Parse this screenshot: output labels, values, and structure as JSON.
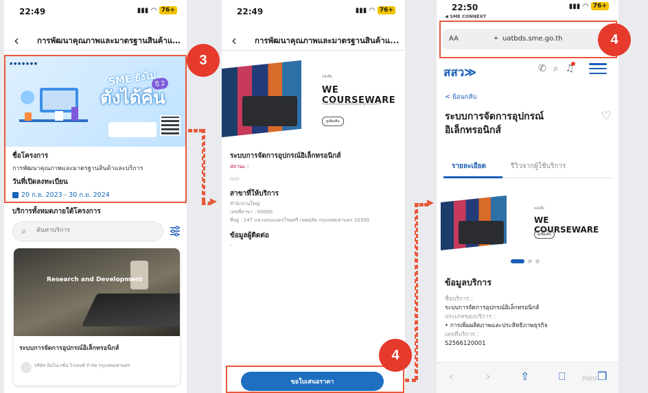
{
  "phone1": {
    "status": {
      "time": "22:49",
      "battery": "76+"
    },
    "nav": {
      "title": "การพัฒนาคุณภาพและมาตรฐานสินค้าแ..."
    },
    "banner": {
      "line1": "SME ยังไม่",
      "line2": "ตังได้คืน",
      "year_badge": "ปี 2"
    },
    "project_label": "ชื่อโครงการ",
    "project_name": "การพัฒนาคุณภาพและมาตรฐานสินค้าและบริการ",
    "open_label": "วันที่เปิดลงทะเบียน",
    "open_dates": "20 ก.ย. 2023 - 30 ก.ย. 2024",
    "services_title": "บริการทั้งหมดภายใต้โครงการ",
    "search_placeholder": "ค้นหาบริการ",
    "card": {
      "image_text": "Research and Development",
      "name": "ระบบการจัดการอุปกรณ์อิเล็กทรอนิกส์",
      "provider": "บริษัท อินโนเวชั่น วิวเลนซ์ จำกัด กรุงเทพมหานคร"
    }
  },
  "phone2": {
    "status": {
      "time": "22:49",
      "battery": "76+"
    },
    "nav": {
      "title": "การพัฒนาคุณภาพและมาตรฐานสินค้าแ..."
    },
    "course": {
      "small": "คลังสื่อ",
      "title": "WE COURSEWARE",
      "desc": "รวมบทเรียนออนไลน์เพื่อพัฒนาผู้ประกอบการ",
      "pill": "ดูเพิ่มเติม"
    },
    "service_name": "ระบบการจัดการอุปกรณ์อิเล็กทรอนิกส์",
    "status_label": "สถานะ :",
    "placeholder_text": "กกก",
    "branch_title": "สาขาที่ให้บริการ",
    "branch_lines": [
      "สำนักงานใหญ่",
      "เลขที่สาขา : 00000",
      "ที่อยู่ : 147 แขวงถนนนครไชยศรี เขตดุสิต กรุงเทพมหานคร 10300"
    ],
    "contact_title": "ข้อมูลผู้ติดต่อ",
    "contact_value": "-",
    "quote_button": "ขอใบเสนอราคา"
  },
  "phone3": {
    "status": {
      "time": "22:50",
      "battery": "76+",
      "back_app": "◀ SME CONNEXT"
    },
    "url_bar": {
      "aa": "AA",
      "url": "uatbds.sme.go.th"
    },
    "logo": "สสว≫",
    "back_link": "< ย้อนกลับ",
    "title": "ระบบการจัดการอุปกรณ์อิเล็กทรอนิกส์",
    "tabs": [
      "รายละเอียด",
      "รีวิวจากผู้ใช้บริการ"
    ],
    "course": {
      "small": "คลังสื่อ",
      "title": "WE COURSEWARE",
      "pill": "ดูเพิ่มเติม"
    },
    "info_title": "ข้อมูลบริการ",
    "info": [
      {
        "k": "ชื่อบริการ :",
        "v": "ระบบการจัดการอุปกรณ์อิเล็กทรอนิกส์"
      },
      {
        "k": "ประเภทของบริการ :",
        "v": "• การเพิ่มผลิตภาพและประสิทธิภาพธุรกิจ"
      },
      {
        "k": "เลขที่บริการ :",
        "v": "S2566120001"
      }
    ],
    "watermark": "miro"
  },
  "annotations": {
    "badge_a": "3",
    "badge_b": "4",
    "badge_c": "4"
  },
  "colors": {
    "accent_red": "#e8583a",
    "brand_blue": "#1a5db7",
    "button_blue": "#1e6fc0"
  }
}
